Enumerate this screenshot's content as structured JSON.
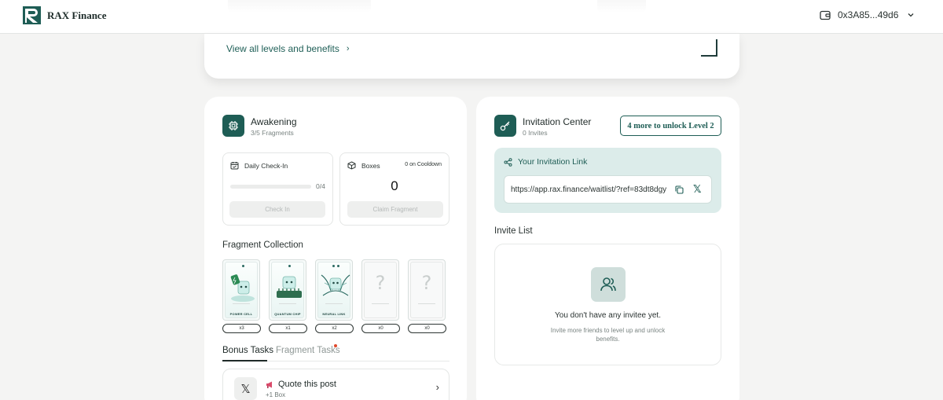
{
  "header": {
    "brand": "RAX Finance",
    "wallet_address": "0x3A85...49d6"
  },
  "top_card": {
    "levels_link": "View all levels and benefits"
  },
  "awakening": {
    "title": "Awakening",
    "subtitle": "3/5 Fragments",
    "checkin": {
      "label": "Daily Check-In",
      "progress_text": "0/4",
      "progress": 0,
      "button": "Check In"
    },
    "boxes": {
      "label": "Boxes",
      "cooldown": "0 on Cooldown",
      "count": "0",
      "button": "Claim Fragment"
    },
    "collection_title": "Fragment Collection",
    "fragments": [
      {
        "name": "POWER CELL",
        "count": "x3",
        "owned": true
      },
      {
        "name": "QUANTUM CHIP",
        "count": "x1",
        "owned": true
      },
      {
        "name": "NEURAL LINK",
        "count": "x2",
        "owned": true
      },
      {
        "name": "",
        "count": "x0",
        "owned": false
      },
      {
        "name": "",
        "count": "x0",
        "owned": false
      }
    ],
    "tabs": {
      "bonus": "Bonus Tasks",
      "fragment": "Fragment Tasks"
    },
    "task": {
      "title": "Quote this post",
      "reward": "+1 Box"
    }
  },
  "invitation": {
    "title": "Invitation Center",
    "subtitle": "0 Invites",
    "unlock_button": "4 more to unlock Level 2",
    "link_heading": "Your Invitation Link",
    "link_url": "https://app.rax.finance/waitlist/?ref=83dt8dgy",
    "invite_list_title": "Invite List",
    "empty_title": "You don't have any invitee yet.",
    "empty_sub": "Invite more friends to level up and unlock benefits."
  },
  "colors": {
    "accent": "#1e5d55",
    "accent_light": "#dcecea",
    "notification": "#e0482b"
  }
}
